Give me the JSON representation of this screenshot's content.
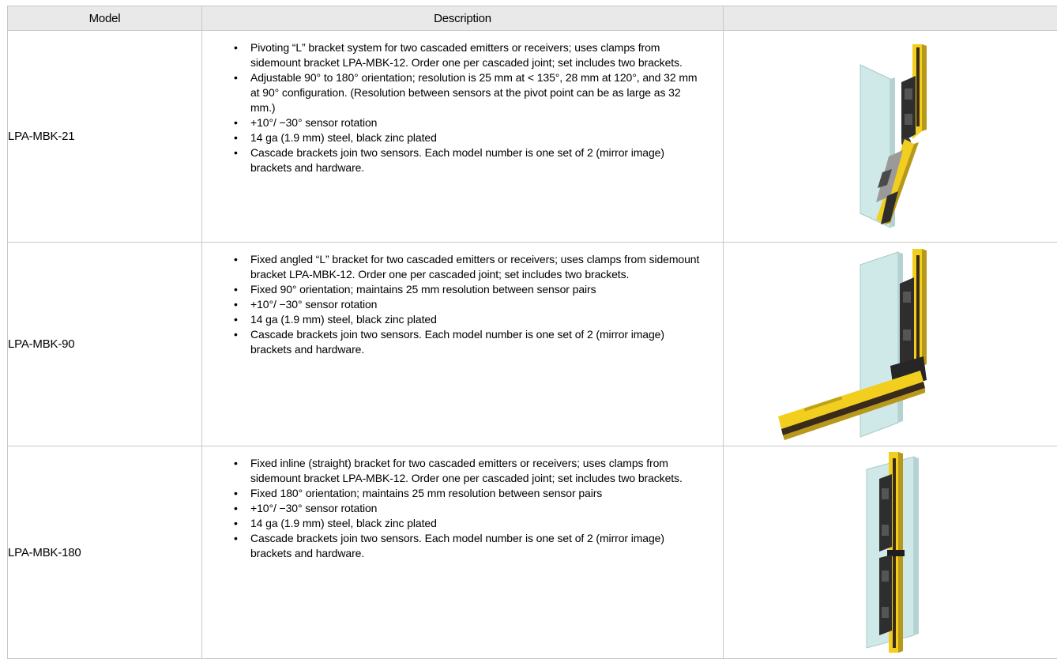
{
  "table": {
    "headers": {
      "model": "Model",
      "description": "Description",
      "image": ""
    },
    "rows": [
      {
        "model": "LPA-MBK-21",
        "image_icon": "pivoting-l-bracket-photo",
        "bullets": [
          "Pivoting “L” bracket system for two cascaded emitters or receivers; uses clamps from sidemount bracket LPA-MBK-12. Order one per cascaded joint; set includes two brackets.",
          "Adjustable 90° to 180° orientation; resolution is 25 mm at < 135°, 28 mm at 120°, and 32 mm at 90° configuration. (Resolution between sensors at the pivot point can be as large as 32 mm.)",
          "+10°/ −30° sensor rotation",
          "14 ga (1.9 mm) steel, black zinc plated",
          "Cascade brackets join two sensors. Each model number is one set of 2 (mirror image) brackets and hardware."
        ]
      },
      {
        "model": "LPA-MBK-90",
        "image_icon": "fixed-angled-l-bracket-photo",
        "bullets": [
          "Fixed angled “L” bracket for two cascaded emitters or receivers; uses clamps from sidemount bracket LPA-MBK-12. Order one per cascaded joint; set includes two brackets.",
          "Fixed 90° orientation; maintains 25 mm resolution between sensor pairs",
          "+10°/ −30° sensor rotation",
          "14 ga (1.9 mm) steel, black zinc plated",
          "Cascade brackets join two sensors. Each model number is one set of 2 (mirror image) brackets and hardware."
        ]
      },
      {
        "model": "LPA-MBK-180",
        "image_icon": "fixed-inline-bracket-photo",
        "bullets": [
          "Fixed inline (straight) bracket for two cascaded emitters or receivers; uses clamps from sidemount bracket LPA-MBK-12. Order one per cascaded joint; set includes two brackets.",
          "Fixed 180° orientation; maintains 25 mm resolution between sensor pairs",
          "+10°/ −30° sensor rotation",
          "14 ga (1.9 mm) steel, black zinc plated",
          "Cascade brackets join two sensors. Each model number is one set of 2 (mirror image) brackets and hardware."
        ]
      }
    ]
  }
}
